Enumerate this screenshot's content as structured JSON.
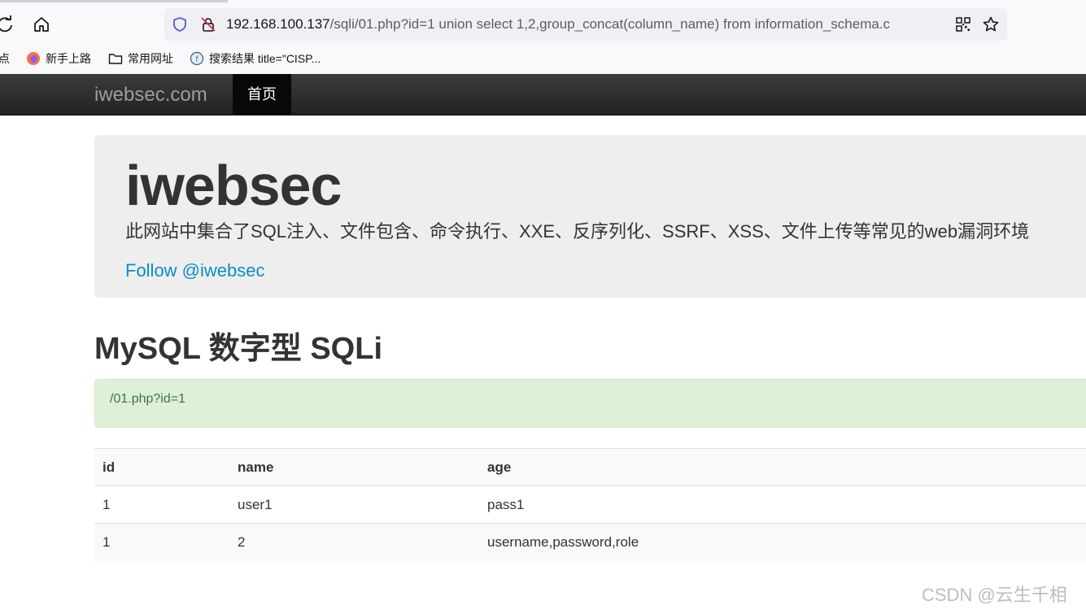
{
  "browser": {
    "url_host": "192.168.100.137",
    "url_rest": "/sqli/01.php?id=1 union select 1,2,group_concat(column_name) from information_schema.c",
    "icons": {
      "reload": "reload-icon",
      "home": "home-icon",
      "shield": "shield-icon",
      "insecure_lock": "insecure-lock-icon",
      "qr": "qr-code-icon",
      "star": "bookmark-star-icon"
    },
    "bookmarks": [
      {
        "label": "点",
        "icon": "bookmark-partial"
      },
      {
        "label": "新手上路",
        "icon": "firefox-icon"
      },
      {
        "label": "常用网址",
        "icon": "folder-icon"
      },
      {
        "label": "搜索结果 title=\"CISP...",
        "icon": "site-favicon-icon"
      }
    ]
  },
  "navbar": {
    "brand": "iwebsec.com",
    "active_item": "首页"
  },
  "jumbotron": {
    "title": "iwebsec",
    "description": "此网站中集合了SQL注入、文件包含、命令执行、XXE、反序列化、SSRF、XSS、文件上传等常见的web漏洞环境",
    "follow_link": "Follow @iwebsec"
  },
  "section": {
    "title": "MySQL 数字型 SQLi",
    "alert_text": "/01.php?id=1"
  },
  "table": {
    "headers": [
      "id",
      "name",
      "age"
    ],
    "rows": [
      [
        "1",
        "user1",
        "pass1"
      ],
      [
        "1",
        "2",
        "username,password,role"
      ]
    ]
  },
  "watermark": "CSDN @云生千相",
  "colors": {
    "navbar_bg": "#222222",
    "link": "#0b8ccc",
    "alert_bg": "#dff0d8",
    "alert_text": "#3c763d",
    "jumbotron_bg": "#eeeeee"
  }
}
